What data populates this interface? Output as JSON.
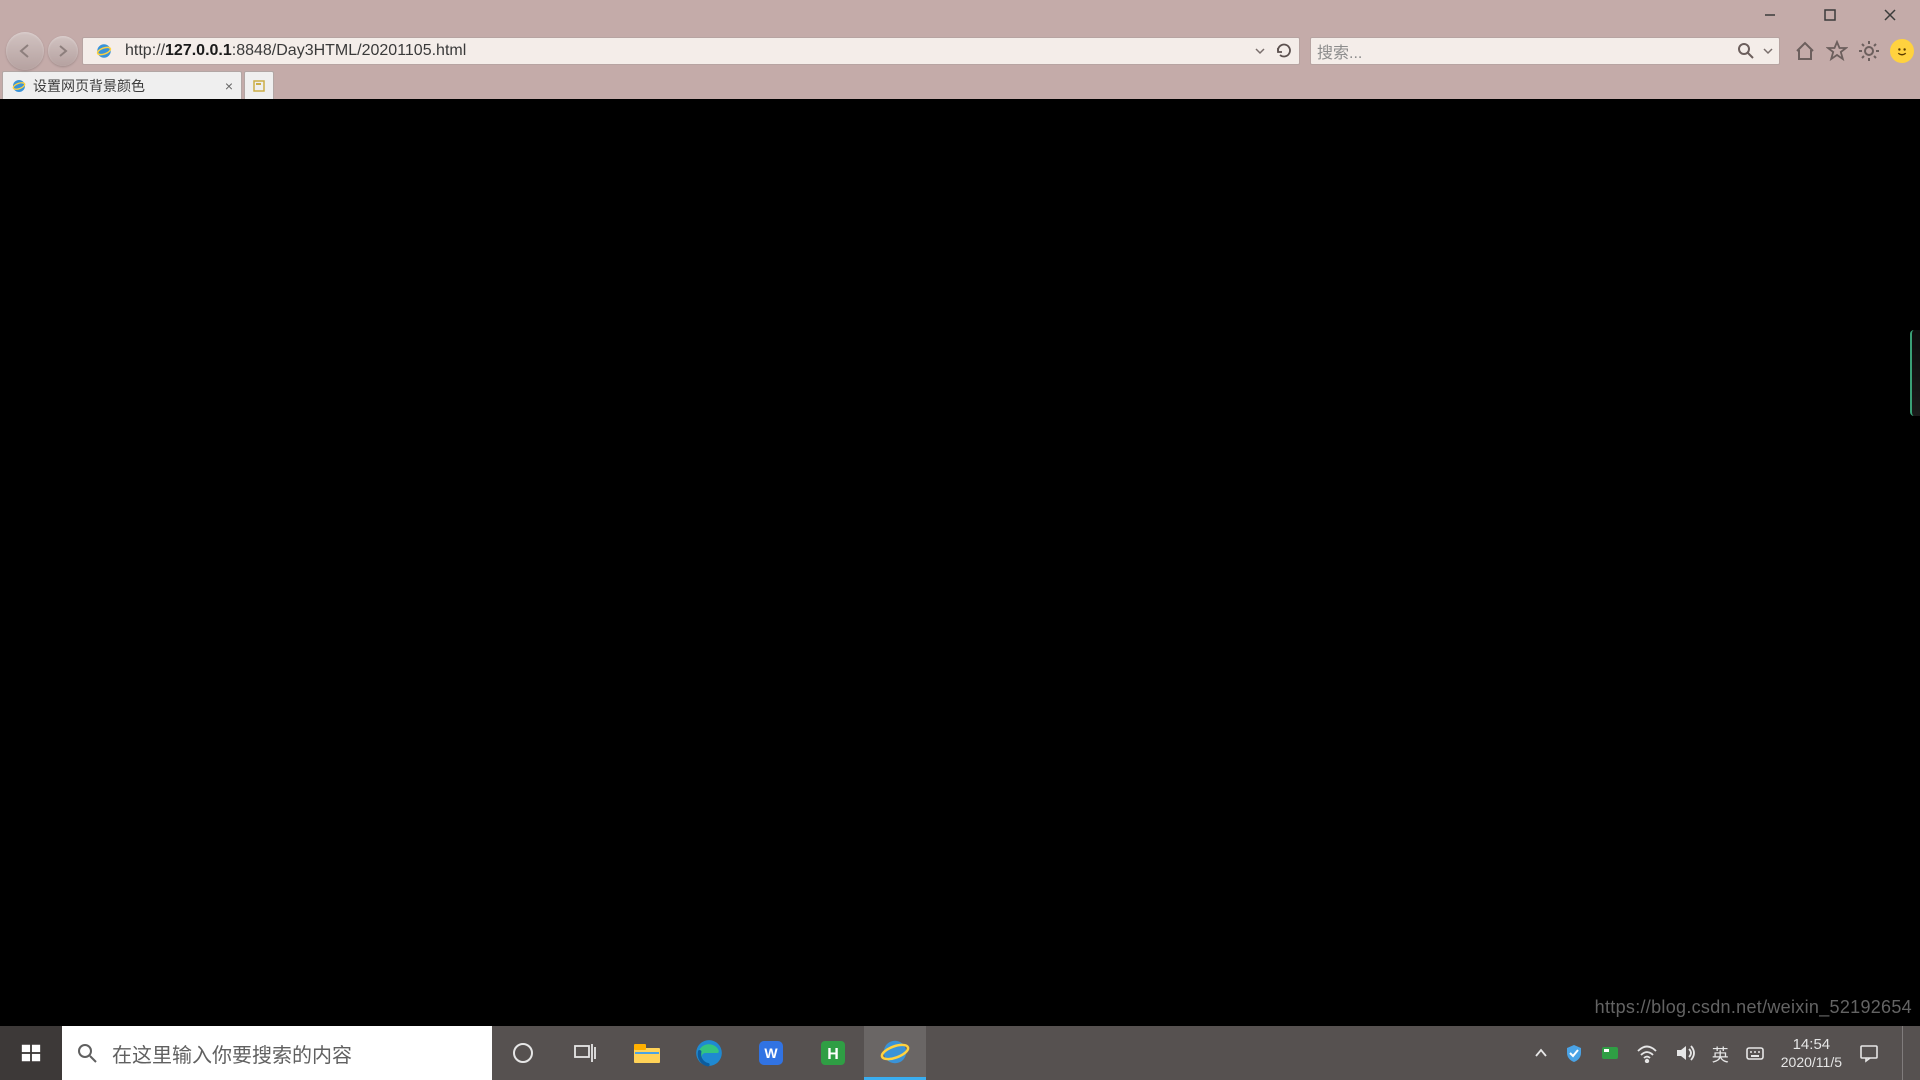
{
  "window": {
    "minimize": "–",
    "maximize": "❐",
    "close": "✕"
  },
  "toolbar": {
    "url_prefix": "http://",
    "url_host": "127.0.0.1",
    "url_rest": ":8848/Day3HTML/20201105.html",
    "search_placeholder": "搜索..."
  },
  "tab": {
    "title": "设置网页背景颜色",
    "close": "×"
  },
  "watermark": "https://blog.csdn.net/weixin_52192654",
  "taskbar": {
    "search_placeholder": "在这里输入你要搜索的内容",
    "ime_lang": "英",
    "time": "14:54",
    "date": "2020/11/5"
  }
}
